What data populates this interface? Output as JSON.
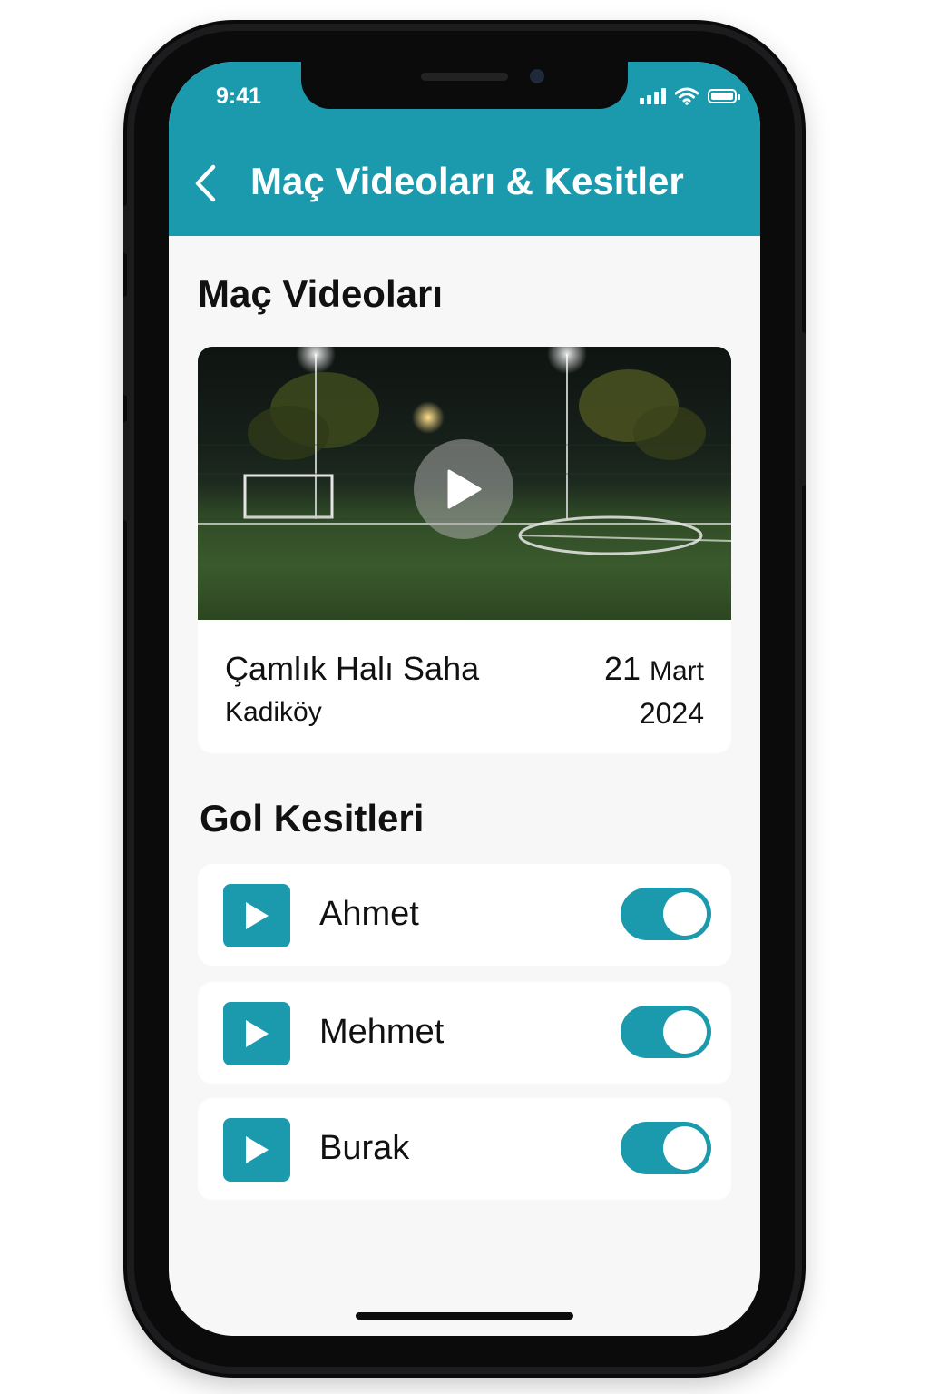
{
  "status_bar": {
    "time": "9:41"
  },
  "header": {
    "title": "Maç Videoları & Kesitler"
  },
  "videos_section": {
    "title": "Maç Videoları",
    "video": {
      "venue": "Çamlık Halı Saha",
      "district": "Kadiköy",
      "day": "21",
      "month": "Mart",
      "year": "2024"
    }
  },
  "clips_section": {
    "title": "Gol Kesitleri",
    "clips": [
      {
        "name": "Ahmet",
        "enabled": true
      },
      {
        "name": "Mehmet",
        "enabled": true
      },
      {
        "name": "Burak",
        "enabled": true
      }
    ]
  },
  "colors": {
    "accent": "#1b9aae",
    "background": "#f7f7f7",
    "card": "#ffffff"
  },
  "icons": {
    "back": "chevron-left-icon",
    "play": "play-icon",
    "signal": "signal-icon",
    "wifi": "wifi-icon",
    "battery": "battery-icon"
  }
}
